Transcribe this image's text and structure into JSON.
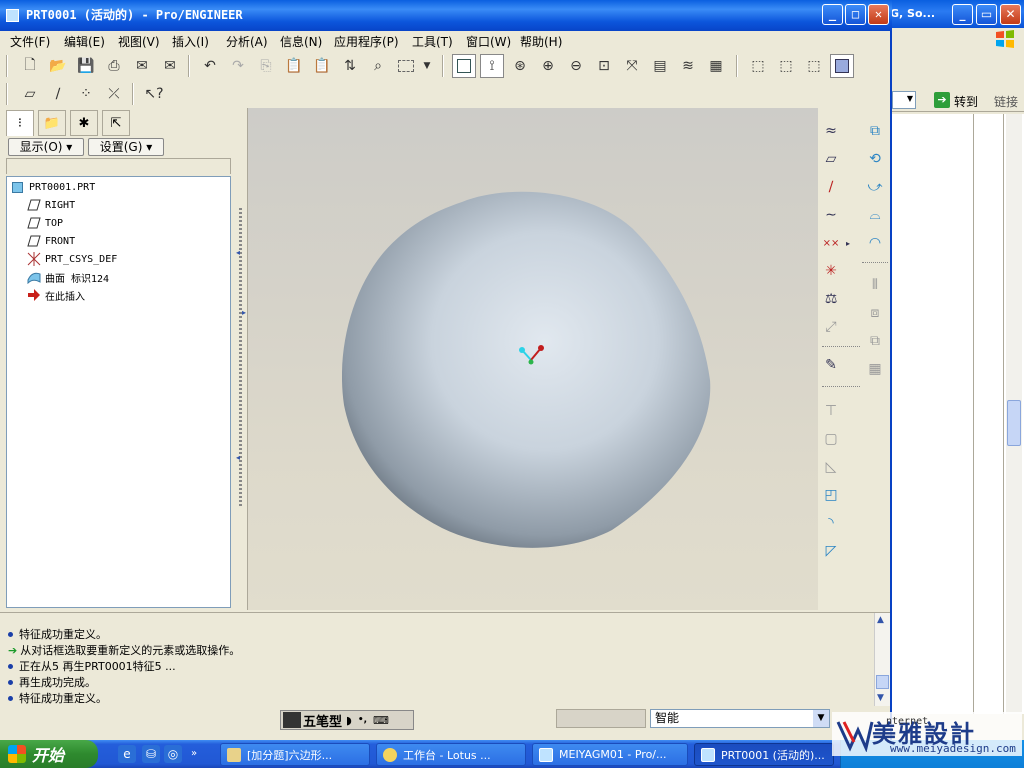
{
  "window": {
    "title": "PRT0001 (活动的) - Pro/ENGINEER",
    "min_label": "_",
    "max_label": "□",
    "close_label": "✕"
  },
  "bg_window": {
    "title_fragment": "G, So...",
    "go_label": "转到",
    "links_label": "链接"
  },
  "menu": [
    "文件(F)",
    "编辑(E)",
    "视图(V)",
    "插入(I)",
    "分析(A)",
    "信息(N)",
    "应用程序(P)",
    "工具(T)",
    "窗口(W)",
    "帮助(H)"
  ],
  "left_panel": {
    "show_button": "显示(O)",
    "settings_button": "设置(G)",
    "tree": [
      {
        "label": "PRT0001.PRT",
        "icon": "part-icon"
      },
      {
        "label": "RIGHT",
        "icon": "datum-plane-icon"
      },
      {
        "label": "TOP",
        "icon": "datum-plane-icon"
      },
      {
        "label": "FRONT",
        "icon": "datum-plane-icon"
      },
      {
        "label": "PRT_CSYS_DEF",
        "icon": "csys-icon"
      },
      {
        "label": "曲面 标识124",
        "icon": "surface-icon"
      },
      {
        "label": "在此插入",
        "icon": "insert-here-arrow-icon"
      }
    ]
  },
  "messages": [
    {
      "text": "特征成功重定义。",
      "kind": "info"
    },
    {
      "text": "从对话框选取要重新定义的元素或选取操作。",
      "kind": "prompt"
    },
    {
      "text": "正在从5 再生PRT0001特征5 ...",
      "kind": "info"
    },
    {
      "text": "再生成功完成。",
      "kind": "info"
    },
    {
      "text": "特征成功重定义。",
      "kind": "info"
    }
  ],
  "status": {
    "ime_label": "五笔型",
    "filter_value": "智能"
  },
  "taskbar": {
    "start_label": "开始",
    "tasks": [
      {
        "label": "[加分题]六边形..."
      },
      {
        "label": "工作台 - Lotus ..."
      },
      {
        "label": "MEIYAGM01 - Pro/..."
      },
      {
        "label": "PRT0001 (活动的)..."
      }
    ],
    "tray_fragment": "nternet"
  },
  "watermark": {
    "name": "美雅設計",
    "url": "www.meiyadesign.com"
  },
  "colors": {
    "title_blue": "#0a5fe0",
    "viewport_bg": "#d6d3c9",
    "model_light": "#dfe6ee",
    "model_dark": "#5f6a76",
    "taskbar_blue": "#245edb",
    "start_green": "#2e8a2e"
  }
}
